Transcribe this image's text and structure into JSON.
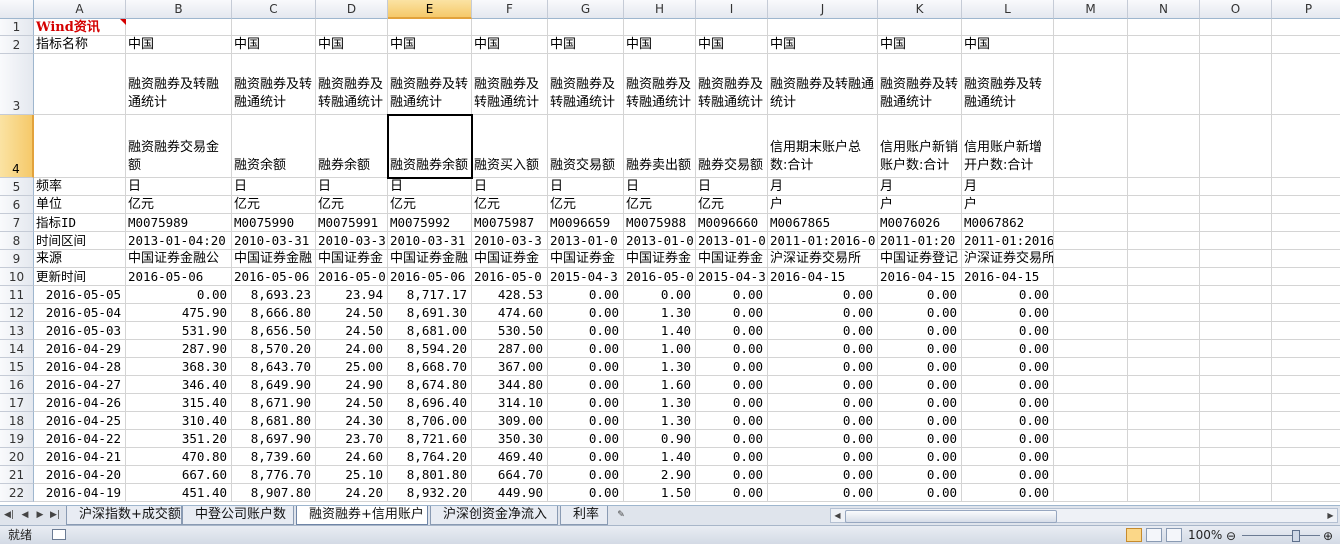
{
  "columns": [
    "A",
    "B",
    "C",
    "D",
    "E",
    "F",
    "G",
    "H",
    "I",
    "J",
    "K",
    "L",
    "M",
    "N",
    "O",
    "P"
  ],
  "selected_cell": "E4",
  "rows": [
    {
      "n": "1",
      "cells": [
        "Wind资讯",
        "",
        "",
        "",
        "",
        "",
        "",
        "",
        "",
        "",
        "",
        ""
      ]
    },
    {
      "n": "2",
      "cells": [
        "指标名称",
        "中国",
        "中国",
        "中国",
        "中国",
        "中国",
        "中国",
        "中国",
        "中国",
        "中国",
        "中国",
        "中国"
      ]
    },
    {
      "n": "3",
      "cells": [
        "",
        "融资融券及转融通统计",
        "融资融券及转融通统计",
        "融资融券及转融通统计",
        "融资融券及转融通统计",
        "融资融券及转融通统计",
        "融资融券及转融通统计",
        "融资融券及转融通统计",
        "融资融券及转融通统计",
        "融资融券及转融通统计",
        "融资融券及转融通统计",
        "融资融券及转融通统计"
      ]
    },
    {
      "n": "4",
      "cells": [
        "",
        "融资融券交易金额",
        "融资余额",
        "融券余额",
        "融资融券余额",
        "融资买入额",
        "融资交易额",
        "融券卖出额",
        "融券交易额",
        "信用期末账户总数:合计",
        "信用账户新销账户数:合计",
        "信用账户新增开户数:合计"
      ]
    },
    {
      "n": "5",
      "cells": [
        "频率",
        "日",
        "日",
        "日",
        "日",
        "日",
        "日",
        "日",
        "日",
        "月",
        "月",
        "月"
      ]
    },
    {
      "n": "6",
      "cells": [
        "单位",
        "亿元",
        "亿元",
        "亿元",
        "亿元",
        "亿元",
        "亿元",
        "亿元",
        "亿元",
        "户",
        "户",
        "户"
      ]
    },
    {
      "n": "7",
      "cells": [
        "指标ID",
        "M0075989",
        "M0075990",
        "M0075991",
        "M0075992",
        "M0075987",
        "M0096659",
        "M0075988",
        "M0096660",
        "M0067865",
        "M0076026",
        "M0067862"
      ]
    },
    {
      "n": "8",
      "cells": [
        "时间区间",
        "2013-01-04:20",
        "2010-03-31",
        "2010-03-3",
        "2010-03-31",
        "2010-03-3",
        "2013-01-0",
        "2013-01-0",
        "2013-01-0",
        "2011-01:2016-0",
        "2011-01:20",
        "2011-01:2016-03"
      ]
    },
    {
      "n": "9",
      "cells": [
        "来源",
        "中国证券金融公",
        "中国证券金融",
        "中国证券金",
        "中国证券金融",
        "中国证券金",
        "中国证券金",
        "中国证券金",
        "中国证券金",
        "沪深证券交易所",
        "中国证券登记",
        "沪深证券交易所"
      ]
    },
    {
      "n": "10",
      "cells": [
        "更新时间",
        "2016-05-06",
        "2016-05-06",
        "2016-05-0",
        "2016-05-06",
        "2016-05-0",
        "2015-04-3",
        "2016-05-0",
        "2015-04-3",
        "2016-04-15",
        "2016-04-15",
        "2016-04-15"
      ]
    },
    {
      "n": "11",
      "cells": [
        "2016-05-05",
        "0.00",
        "8,693.23",
        "23.94",
        "8,717.17",
        "428.53",
        "0.00",
        "0.00",
        "0.00",
        "0.00",
        "0.00",
        "0.00"
      ]
    },
    {
      "n": "12",
      "cells": [
        "2016-05-04",
        "475.90",
        "8,666.80",
        "24.50",
        "8,691.30",
        "474.60",
        "0.00",
        "1.30",
        "0.00",
        "0.00",
        "0.00",
        "0.00"
      ]
    },
    {
      "n": "13",
      "cells": [
        "2016-05-03",
        "531.90",
        "8,656.50",
        "24.50",
        "8,681.00",
        "530.50",
        "0.00",
        "1.40",
        "0.00",
        "0.00",
        "0.00",
        "0.00"
      ]
    },
    {
      "n": "14",
      "cells": [
        "2016-04-29",
        "287.90",
        "8,570.20",
        "24.00",
        "8,594.20",
        "287.00",
        "0.00",
        "1.00",
        "0.00",
        "0.00",
        "0.00",
        "0.00"
      ]
    },
    {
      "n": "15",
      "cells": [
        "2016-04-28",
        "368.30",
        "8,643.70",
        "25.00",
        "8,668.70",
        "367.00",
        "0.00",
        "1.30",
        "0.00",
        "0.00",
        "0.00",
        "0.00"
      ]
    },
    {
      "n": "16",
      "cells": [
        "2016-04-27",
        "346.40",
        "8,649.90",
        "24.90",
        "8,674.80",
        "344.80",
        "0.00",
        "1.60",
        "0.00",
        "0.00",
        "0.00",
        "0.00"
      ]
    },
    {
      "n": "17",
      "cells": [
        "2016-04-26",
        "315.40",
        "8,671.90",
        "24.50",
        "8,696.40",
        "314.10",
        "0.00",
        "1.30",
        "0.00",
        "0.00",
        "0.00",
        "0.00"
      ]
    },
    {
      "n": "18",
      "cells": [
        "2016-04-25",
        "310.40",
        "8,681.80",
        "24.30",
        "8,706.00",
        "309.00",
        "0.00",
        "1.30",
        "0.00",
        "0.00",
        "0.00",
        "0.00"
      ]
    },
    {
      "n": "19",
      "cells": [
        "2016-04-22",
        "351.20",
        "8,697.90",
        "23.70",
        "8,721.60",
        "350.30",
        "0.00",
        "0.90",
        "0.00",
        "0.00",
        "0.00",
        "0.00"
      ]
    },
    {
      "n": "20",
      "cells": [
        "2016-04-21",
        "470.80",
        "8,739.60",
        "24.60",
        "8,764.20",
        "469.40",
        "0.00",
        "1.40",
        "0.00",
        "0.00",
        "0.00",
        "0.00"
      ]
    },
    {
      "n": "21",
      "cells": [
        "2016-04-20",
        "667.60",
        "8,776.70",
        "25.10",
        "8,801.80",
        "664.70",
        "0.00",
        "2.90",
        "0.00",
        "0.00",
        "0.00",
        "0.00"
      ]
    },
    {
      "n": "22",
      "cells": [
        "2016-04-19",
        "451.40",
        "8,907.80",
        "24.20",
        "8,932.20",
        "449.90",
        "0.00",
        "1.50",
        "0.00",
        "0.00",
        "0.00",
        "0.00"
      ]
    }
  ],
  "sheet_tabs": [
    "沪深指数+成交额",
    "中登公司账户数",
    "融资融券+信用账户",
    "沪深创资金净流入",
    "利率"
  ],
  "active_tab_index": 2,
  "status": {
    "ready_text": "就绪",
    "zoom": "100%"
  },
  "colors": {
    "accent": "#f5c96a",
    "wind_red": "#d40000",
    "tab_bar": "#dfe4ec"
  }
}
